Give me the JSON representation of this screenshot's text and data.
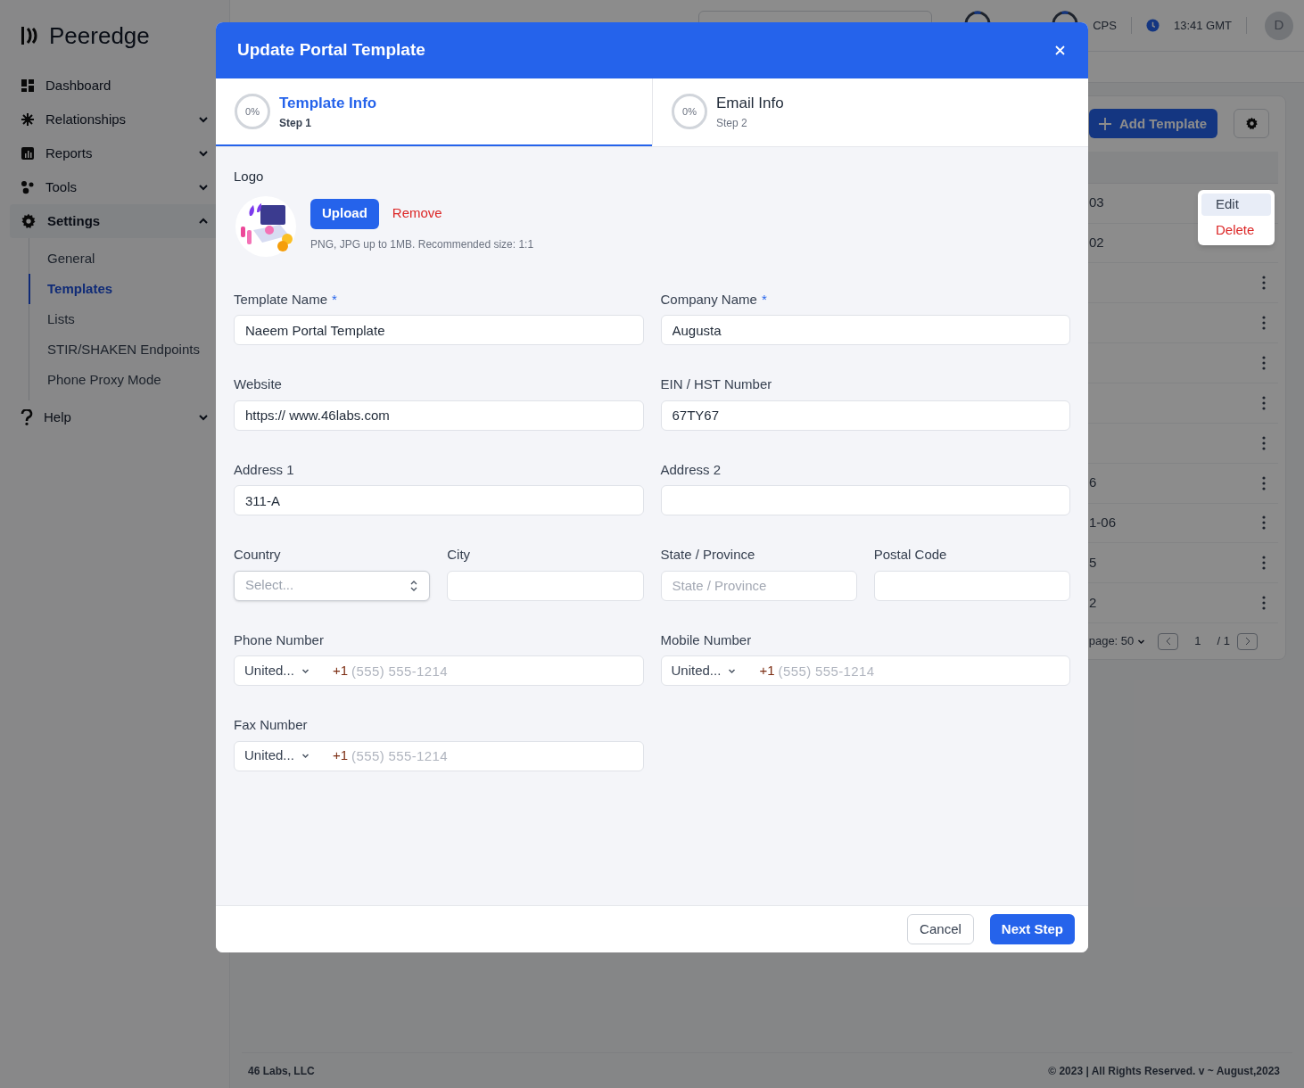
{
  "sidebar": {
    "brand": "Peeredge",
    "items": [
      {
        "label": "Dashboard"
      },
      {
        "label": "Relationships",
        "expanded": false
      },
      {
        "label": "Reports",
        "expanded": false
      },
      {
        "label": "Tools",
        "expanded": false
      },
      {
        "label": "Settings",
        "expanded": true,
        "children": [
          {
            "label": "General",
            "selected": false
          },
          {
            "label": "Templates",
            "selected": true
          },
          {
            "label": "Lists",
            "selected": false
          },
          {
            "label": "STIR/SHAKEN Endpoints",
            "selected": false
          },
          {
            "label": "Phone Proxy Mode",
            "selected": false
          }
        ]
      },
      {
        "label": "Help",
        "expanded": false
      }
    ]
  },
  "header": {
    "gauge_label": "CPS",
    "time": "13:41 GMT",
    "avatar": "D"
  },
  "page": {
    "add_button": "Add Template",
    "rows": [
      {
        "cell": "03"
      },
      {
        "cell": "02"
      },
      {},
      {},
      {},
      {},
      {},
      {
        "cell": "6"
      },
      {
        "cell": "1-06"
      },
      {
        "cell": "5"
      },
      {
        "cell": "2"
      }
    ],
    "pagination": {
      "per_page": "page: 50",
      "page": "1",
      "total": "/ 1"
    }
  },
  "row_menu": {
    "items": [
      {
        "label": "Edit",
        "kind": "normal",
        "selected": true
      },
      {
        "label": "Delete",
        "kind": "danger",
        "selected": false
      }
    ]
  },
  "footer": {
    "left": "46 Labs, LLC",
    "right": "© 2023 | All Rights Reserved. v ~ August,2023"
  },
  "modal": {
    "title": "Update Portal Template",
    "steps": [
      {
        "progress": "0%",
        "title": "Template Info",
        "subtitle": "Step 1",
        "selected": true
      },
      {
        "progress": "0%",
        "title": "Email Info",
        "subtitle": "Step 2",
        "selected": false
      }
    ],
    "logo": {
      "label": "Logo",
      "upload": "Upload",
      "remove": "Remove",
      "hint": "PNG, JPG up to 1MB. Recommended size: 1:1"
    },
    "rows": [
      [
        {
          "kind": "text",
          "label": "Template Name",
          "required_mark": "*",
          "value": "Naeem Portal Template"
        },
        {
          "kind": "text",
          "label": "Company Name",
          "required_mark": "*",
          "value": "Augusta"
        }
      ],
      [
        {
          "kind": "text",
          "label": "Website",
          "value": "https:// www.46labs.com"
        },
        {
          "kind": "text",
          "label": "EIN / HST Number",
          "value": "67TY67"
        }
      ],
      [
        {
          "kind": "text",
          "label": "Address 1",
          "value": "311-A"
        },
        {
          "kind": "text",
          "label": "Address 2"
        }
      ],
      [
        {
          "kind": "select",
          "label": "Country",
          "placeholder": "Select..."
        },
        {
          "kind": "text",
          "label": "City"
        },
        {
          "kind": "text",
          "label": "State / Province",
          "placeholder": "State / Province"
        },
        {
          "kind": "text",
          "label": "Postal Code"
        }
      ],
      [
        {
          "kind": "phone",
          "label": "Phone Number",
          "country": "United...",
          "code": "+1",
          "placeholder": "(555) 555-1214"
        },
        {
          "kind": "phone",
          "label": "Mobile Number",
          "country": "United...",
          "code": "+1",
          "placeholder": "(555) 555-1214"
        }
      ],
      [
        {
          "kind": "phone",
          "label": "Fax Number",
          "country": "United...",
          "code": "+1",
          "placeholder": "(555) 555-1214"
        }
      ]
    ],
    "cancel": "Cancel",
    "next": "Next Step"
  }
}
